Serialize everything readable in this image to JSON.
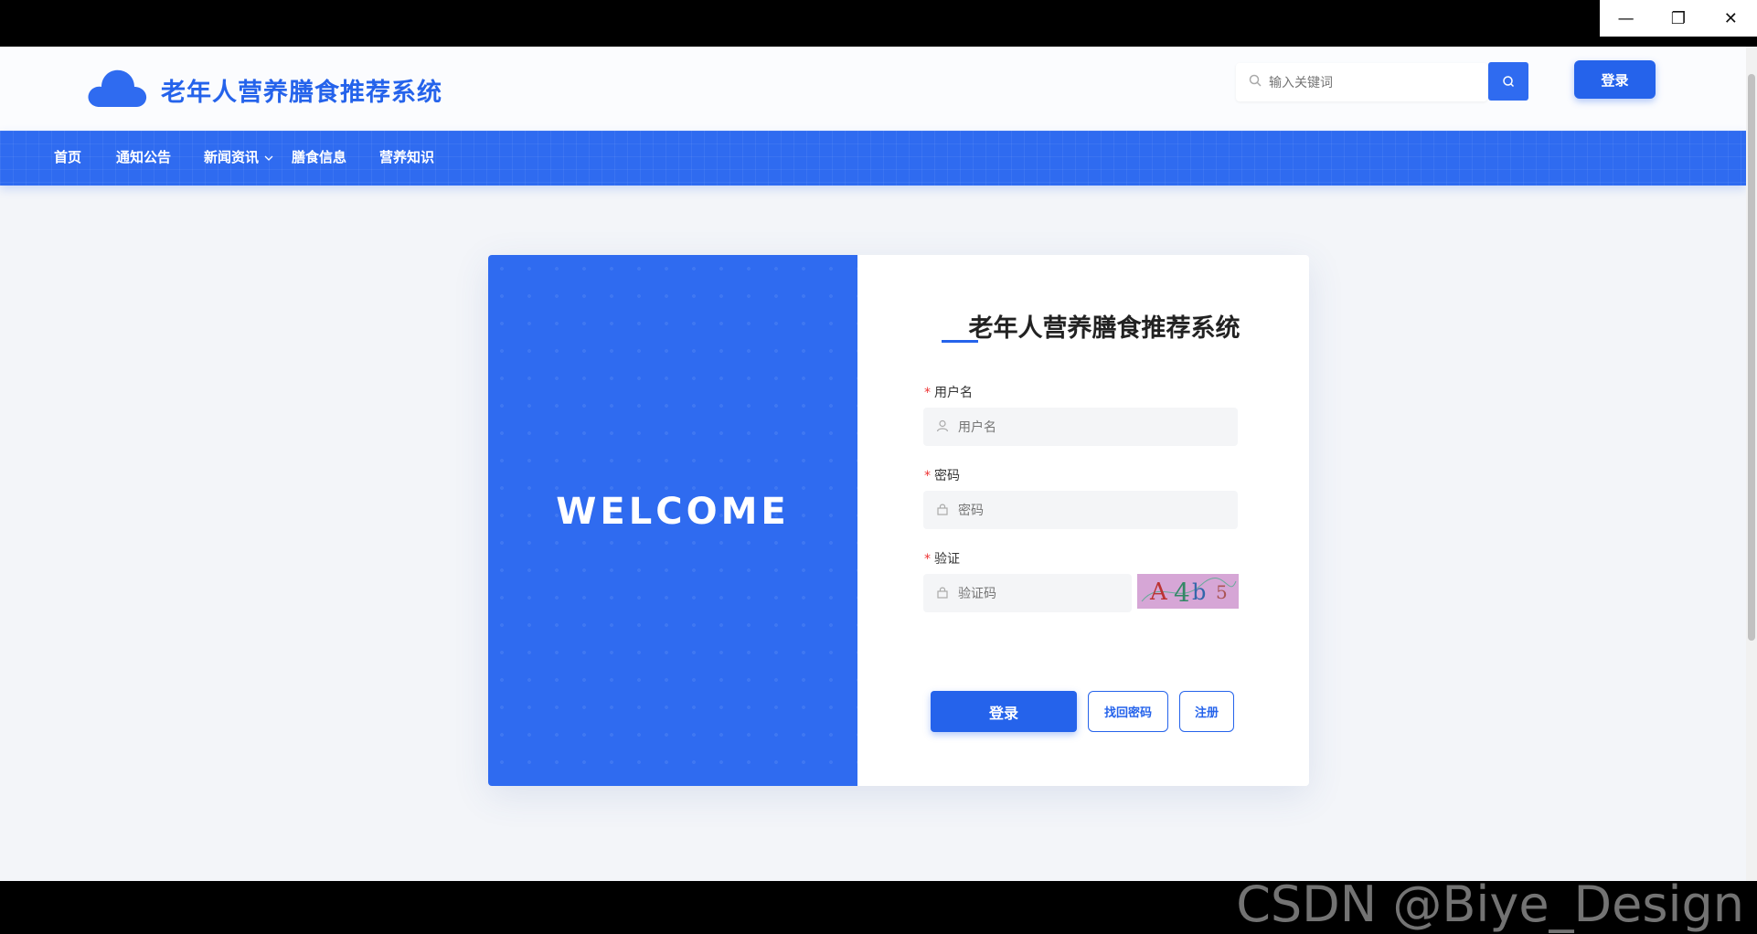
{
  "window": {
    "minimize": "—",
    "restore": "❐",
    "close": "✕"
  },
  "header": {
    "site_title": "老年人营养膳食推荐系统",
    "search_placeholder": "输入关键词",
    "login_label": "登录"
  },
  "nav": {
    "items": [
      {
        "label": "首页"
      },
      {
        "label": "通知公告"
      },
      {
        "label": "新闻资讯"
      },
      {
        "label": "膳食信息"
      },
      {
        "label": "营养知识"
      }
    ]
  },
  "card": {
    "welcome": "WELCOME",
    "title": "老年人营养膳食推荐系统",
    "username_label": "用户名",
    "username_placeholder": "用户名",
    "password_label": "密码",
    "password_placeholder": "密码",
    "verify_label": "验证",
    "verify_placeholder": "验证码",
    "captcha_text": "A4b5",
    "login_button": "登录",
    "forgot_button": "找回密码",
    "register_button": "注册"
  },
  "watermark": "CSDN @Biye_Design",
  "colors": {
    "accent": "#2563eb",
    "nav": "#2f6bf0"
  }
}
